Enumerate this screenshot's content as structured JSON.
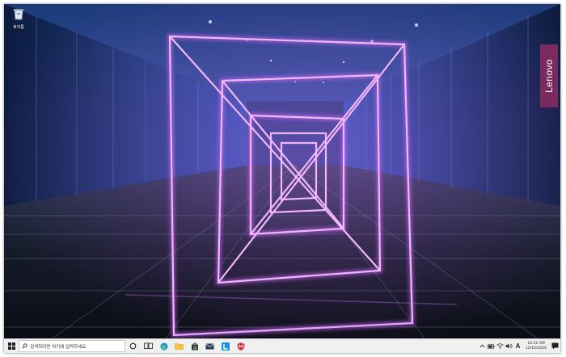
{
  "desktop": {
    "recycle_bin_label": "휴지통",
    "brand_logo_text": "Lenovo",
    "wallpaper": "neon-corridor"
  },
  "taskbar": {
    "start_icon": "windows-logo-icon",
    "search_placeholder": "검색하려면 여기에 입력하세요.",
    "pinned": [
      "cortana-circle-icon",
      "task-view-icon",
      "edge-icon",
      "file-explorer-icon",
      "store-icon",
      "mail-icon",
      "lenovo-vantage-icon",
      "mcafee-icon"
    ]
  },
  "tray": {
    "ime_indicator": "A",
    "time": "10:32 AM",
    "date": "12/10/2020"
  },
  "colors": {
    "taskbar_bg": "#f0f0f0",
    "brand_bg": "#7a2a5e",
    "neon": "#e07cff"
  }
}
